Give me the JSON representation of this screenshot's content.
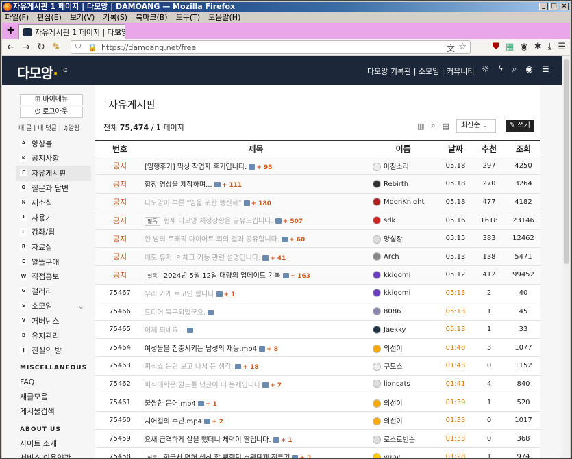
{
  "window": {
    "title": "자유게시판 1 페이지 | 다모앙 | DAMOANG — Mozilla Firefox",
    "menu": [
      "파일(F)",
      "편집(E)",
      "보기(V)",
      "기록(S)",
      "북마크(B)",
      "도구(T)",
      "도움말(H)"
    ],
    "tab_title": "자유게시판 1 페이지 | 다모앙",
    "url": "https://damoang.net/free"
  },
  "site": {
    "logo": "다모앙",
    "alpha": "α",
    "nav": "다모앙 기록관 | 소모임 | 커뮤니티"
  },
  "sidebar": {
    "my_menu": "⊞ 마이메뉴",
    "logout": "⏻ 로그아웃",
    "links": "내 글 | 내 댓글 | ♫알림",
    "items": [
      {
        "key": "A",
        "label": "앙상불"
      },
      {
        "key": "K",
        "label": "공지사항"
      },
      {
        "key": "F",
        "label": "자유게시판"
      },
      {
        "key": "Q",
        "label": "질문과 답변"
      },
      {
        "key": "N",
        "label": "새소식"
      },
      {
        "key": "T",
        "label": "사용기"
      },
      {
        "key": "L",
        "label": "강좌/팁"
      },
      {
        "key": "R",
        "label": "자료실"
      },
      {
        "key": "E",
        "label": "알뜰구매"
      },
      {
        "key": "W",
        "label": "직접홍보"
      },
      {
        "key": "G",
        "label": "갤러리"
      },
      {
        "key": "S",
        "label": "소모임"
      },
      {
        "key": "V",
        "label": "거버넌스"
      },
      {
        "key": "B",
        "label": "유지관리"
      },
      {
        "key": "J",
        "label": "진실의 방"
      }
    ],
    "misc_head": "MISCELLANEOUS",
    "misc": [
      "FAQ",
      "새글모음",
      "게시물검색"
    ],
    "about_head": "ABOUT US",
    "about": [
      "사이트 소개",
      "서비스 이용약관"
    ]
  },
  "board": {
    "title": "자유게시판",
    "total_label": "전체",
    "total": "75,474",
    "pages": "/ 1 페이지",
    "sort": "최신순",
    "write": "✎ 쓰기",
    "headers": [
      "번호",
      "제목",
      "이름",
      "날짜",
      "추천",
      "조회"
    ],
    "rows": [
      {
        "no": "공지",
        "title": "[임행후기] 믹싱 작업자 후기입니다.",
        "c": "+ 95",
        "name": "아침소리",
        "date": "05.18",
        "rec": "297",
        "view": "4250",
        "notice": true
      },
      {
        "no": "공지",
        "title": "합창 영상을 제작하며...",
        "c": "+ 111",
        "name": "Rebirth",
        "date": "05.18",
        "rec": "270",
        "view": "3264",
        "notice": true
      },
      {
        "no": "공지",
        "title": "다모앙이 부른 \"임을 위한 행진곡\"",
        "c": "+ 180",
        "name": "MoonKnight",
        "date": "05.18",
        "rec": "477",
        "view": "4182",
        "notice": true,
        "gray": true
      },
      {
        "no": "공지",
        "badge": "필독",
        "title": "현재 다모앙 재정상황을 공유드립니다.",
        "c": "+ 507",
        "name": "sdk",
        "date": "05.16",
        "rec": "1618",
        "view": "23146",
        "notice": true,
        "gray": true
      },
      {
        "no": "공지",
        "title": "한 밤의 트래픽 다이어트 회의 결과 공유합니다.",
        "c": "+ 60",
        "name": "앙실장",
        "date": "05.15",
        "rec": "383",
        "view": "12462",
        "notice": true,
        "gray": true
      },
      {
        "no": "공지",
        "title": "메모 유저 IP 체크 기능 관련 설명입니다.",
        "c": "+ 41",
        "name": "Arch",
        "date": "05.13",
        "rec": "138",
        "view": "5471",
        "notice": true,
        "gray": true
      },
      {
        "no": "공지",
        "badge": "필독",
        "title": "2024년 5월 12일 대량의 업데이트 기록",
        "c": "+ 163",
        "name": "kkigomi",
        "date": "05.12",
        "rec": "412",
        "view": "99452",
        "notice": true
      },
      {
        "no": "75467",
        "title": "우리 가게 로고인 합니다",
        "c": "+ 1",
        "name": "kkigomi",
        "date": "05:13",
        "rec": "2",
        "view": "40",
        "gray": true
      },
      {
        "no": "75466",
        "title": "드디어 복구되었군요.",
        "c": "",
        "name": "8086",
        "date": "05:13",
        "rec": "1",
        "view": "45",
        "gray": true
      },
      {
        "no": "75465",
        "title": "이제 되네요...",
        "c": "",
        "name": "Jaekky",
        "date": "05:13",
        "rec": "1",
        "view": "33",
        "gray": true
      },
      {
        "no": "75464",
        "title": "여성들을 집중시키는 남성의 재능.mp4",
        "c": "+ 8",
        "name": "외선이",
        "date": "01:48",
        "rec": "3",
        "view": "1077"
      },
      {
        "no": "75463",
        "title": "피식쇼 논란 보고 나서 든 생각.",
        "c": "+ 18",
        "name": "쿠도스",
        "date": "01:43",
        "rec": "0",
        "view": "1152",
        "gray": true
      },
      {
        "no": "75462",
        "title": "피식대학은 쉴드를 댓글이 더 문제입니다",
        "c": "+ 7",
        "name": "lioncats",
        "date": "01:41",
        "rec": "4",
        "view": "840",
        "gray": true
      },
      {
        "no": "75461",
        "title": "불쌍한 문어.mp4",
        "c": "+ 1",
        "name": "외선이",
        "date": "01:39",
        "rec": "1",
        "view": "520"
      },
      {
        "no": "75460",
        "title": "치어걸의 수난.mp4",
        "c": "+ 2",
        "name": "외선이",
        "date": "01:33",
        "rec": "0",
        "view": "1017"
      },
      {
        "no": "75459",
        "title": "요새 급격하게 살을 뺐더니 체력이 딸립니다.",
        "c": "+ 1",
        "name": "로스로빈슨",
        "date": "01:33",
        "rec": "0",
        "view": "368"
      },
      {
        "no": "75458",
        "badge": "필독",
        "title": "한국서 면허 생산 할 뻔했던 스웨덴제 전투기",
        "c": "+ 2",
        "name": "yuhy",
        "date": "01:28",
        "rec": "1",
        "view": "974"
      }
    ]
  }
}
